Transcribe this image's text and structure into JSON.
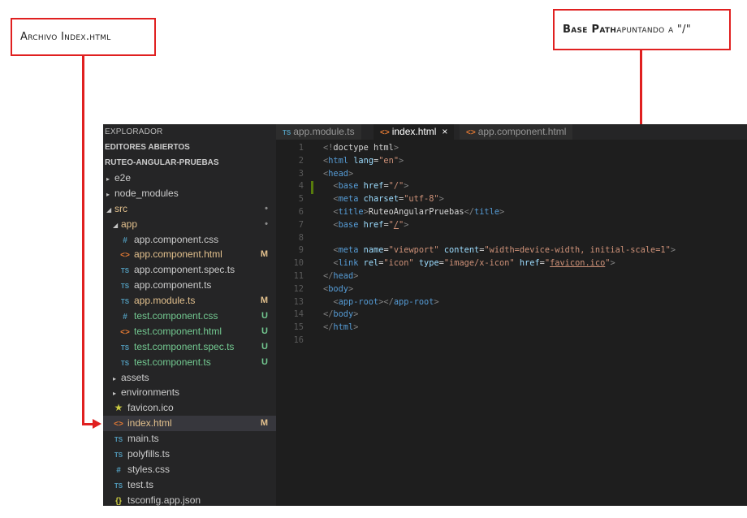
{
  "annotations": {
    "left_label": "Archivo Index.html",
    "right_label_bold": "Base Path",
    "right_label_rest": " apuntando a \"/\""
  },
  "sidebar": {
    "header": "EXPLORADOR",
    "open_editors": "EDITORES ABIERTOS",
    "project": "RUTEO-ANGULAR-PRUEBAS",
    "items": [
      {
        "label": "e2e",
        "icon": "chevron-right",
        "depth": 0,
        "badge": "",
        "color": "default"
      },
      {
        "label": "node_modules",
        "icon": "chevron-right",
        "depth": 0,
        "badge": "",
        "color": "default"
      },
      {
        "label": "src",
        "icon": "chevron-down",
        "depth": 0,
        "badge": "•",
        "color": "mod"
      },
      {
        "label": "app",
        "icon": "chevron-down",
        "depth": 1,
        "badge": "•",
        "color": "mod"
      },
      {
        "label": "app.component.css",
        "icon": "css-icon",
        "depth": 2,
        "badge": "",
        "color": "default"
      },
      {
        "label": "app.component.html",
        "icon": "html-icon",
        "depth": 2,
        "badge": "M",
        "color": "mod"
      },
      {
        "label": "app.component.spec.ts",
        "icon": "ts-icon",
        "depth": 2,
        "badge": "",
        "color": "default"
      },
      {
        "label": "app.component.ts",
        "icon": "ts-icon",
        "depth": 2,
        "badge": "",
        "color": "default"
      },
      {
        "label": "app.module.ts",
        "icon": "ts-icon",
        "depth": 2,
        "badge": "M",
        "color": "mod"
      },
      {
        "label": "test.component.css",
        "icon": "css-icon",
        "depth": 2,
        "badge": "U",
        "color": "new"
      },
      {
        "label": "test.component.html",
        "icon": "html-icon",
        "depth": 2,
        "badge": "U",
        "color": "new"
      },
      {
        "label": "test.component.spec.ts",
        "icon": "ts-icon",
        "depth": 2,
        "badge": "U",
        "color": "new"
      },
      {
        "label": "test.component.ts",
        "icon": "ts-icon",
        "depth": 2,
        "badge": "U",
        "color": "new"
      },
      {
        "label": "assets",
        "icon": "chevron-right",
        "depth": 1,
        "badge": "",
        "color": "default"
      },
      {
        "label": "environments",
        "icon": "chevron-right",
        "depth": 1,
        "badge": "",
        "color": "default"
      },
      {
        "label": "favicon.ico",
        "icon": "star-icon",
        "depth": 1,
        "badge": "",
        "color": "default"
      },
      {
        "label": "index.html",
        "icon": "html-icon",
        "depth": 1,
        "badge": "M",
        "color": "mod",
        "selected": true
      },
      {
        "label": "main.ts",
        "icon": "ts-icon",
        "depth": 1,
        "badge": "",
        "color": "default"
      },
      {
        "label": "polyfills.ts",
        "icon": "ts-icon",
        "depth": 1,
        "badge": "",
        "color": "default"
      },
      {
        "label": "styles.css",
        "icon": "css-icon",
        "depth": 1,
        "badge": "",
        "color": "default"
      },
      {
        "label": "test.ts",
        "icon": "ts-icon",
        "depth": 1,
        "badge": "",
        "color": "default"
      },
      {
        "label": "tsconfig.app.json",
        "icon": "json-icon",
        "depth": 1,
        "badge": "",
        "color": "default"
      }
    ]
  },
  "tabs": [
    {
      "label": "app.module.ts",
      "icon": "ts-icon",
      "active": false
    },
    {
      "label": "index.html",
      "icon": "html-icon",
      "active": true,
      "close": "×"
    },
    {
      "label": "app.component.html",
      "icon": "html-icon",
      "active": false
    }
  ],
  "icon_glyphs": {
    "ts": "TS",
    "css": "#",
    "html": "<>",
    "json": "{}",
    "star": "★",
    "chevron-right": "▸",
    "chevron-down": "◢"
  },
  "code": [
    {
      "n": "1",
      "t": [
        [
          "pu",
          "<!"
        ],
        [
          "tx",
          "doctype html"
        ],
        [
          "pu",
          ">"
        ]
      ]
    },
    {
      "n": "2",
      "t": [
        [
          "pu",
          "<"
        ],
        [
          "tg",
          "html"
        ],
        [
          "tx",
          " "
        ],
        [
          "an",
          "lang"
        ],
        [
          "tx",
          "="
        ],
        [
          "av",
          "\"en\""
        ],
        [
          "pu",
          ">"
        ]
      ]
    },
    {
      "n": "3",
      "t": [
        [
          "pu",
          "<"
        ],
        [
          "tg",
          "head"
        ],
        [
          "pu",
          ">"
        ]
      ]
    },
    {
      "n": "4",
      "t": [
        [
          "tx",
          "  "
        ],
        [
          "pu",
          "<"
        ],
        [
          "tg",
          "base"
        ],
        [
          "tx",
          " "
        ],
        [
          "an",
          "href"
        ],
        [
          "tx",
          "="
        ],
        [
          "av",
          "\"/\""
        ],
        [
          "pu",
          ">"
        ]
      ],
      "mod": true
    },
    {
      "n": "5",
      "t": [
        [
          "tx",
          "  "
        ],
        [
          "pu",
          "<"
        ],
        [
          "tg",
          "meta"
        ],
        [
          "tx",
          " "
        ],
        [
          "an",
          "charset"
        ],
        [
          "tx",
          "="
        ],
        [
          "av",
          "\"utf-8\""
        ],
        [
          "pu",
          ">"
        ]
      ]
    },
    {
      "n": "6",
      "t": [
        [
          "tx",
          "  "
        ],
        [
          "pu",
          "<"
        ],
        [
          "tg",
          "title"
        ],
        [
          "pu",
          ">"
        ],
        [
          "tx",
          "RuteoAngularPruebas"
        ],
        [
          "pu",
          "</"
        ],
        [
          "tg",
          "title"
        ],
        [
          "pu",
          ">"
        ]
      ]
    },
    {
      "n": "7",
      "t": [
        [
          "tx",
          "  "
        ],
        [
          "pu",
          "<"
        ],
        [
          "tg",
          "base"
        ],
        [
          "tx",
          " "
        ],
        [
          "an",
          "href"
        ],
        [
          "tx",
          "="
        ],
        [
          "av",
          "\""
        ],
        [
          "av ul",
          "/"
        ],
        [
          "av",
          "\""
        ],
        [
          "pu",
          ">"
        ]
      ]
    },
    {
      "n": "8",
      "t": []
    },
    {
      "n": "9",
      "t": [
        [
          "tx",
          "  "
        ],
        [
          "pu",
          "<"
        ],
        [
          "tg",
          "meta"
        ],
        [
          "tx",
          " "
        ],
        [
          "an",
          "name"
        ],
        [
          "tx",
          "="
        ],
        [
          "av",
          "\"viewport\""
        ],
        [
          "tx",
          " "
        ],
        [
          "an",
          "content"
        ],
        [
          "tx",
          "="
        ],
        [
          "av",
          "\"width=device-width, initial-scale=1\""
        ],
        [
          "pu",
          ">"
        ]
      ]
    },
    {
      "n": "10",
      "t": [
        [
          "tx",
          "  "
        ],
        [
          "pu",
          "<"
        ],
        [
          "tg",
          "link"
        ],
        [
          "tx",
          " "
        ],
        [
          "an",
          "rel"
        ],
        [
          "tx",
          "="
        ],
        [
          "av",
          "\"icon\""
        ],
        [
          "tx",
          " "
        ],
        [
          "an",
          "type"
        ],
        [
          "tx",
          "="
        ],
        [
          "av",
          "\"image/x-icon\""
        ],
        [
          "tx",
          " "
        ],
        [
          "an",
          "href"
        ],
        [
          "tx",
          "="
        ],
        [
          "av",
          "\""
        ],
        [
          "av ul",
          "favicon.ico"
        ],
        [
          "av",
          "\""
        ],
        [
          "pu",
          ">"
        ]
      ]
    },
    {
      "n": "11",
      "t": [
        [
          "pu",
          "</"
        ],
        [
          "tg",
          "head"
        ],
        [
          "pu",
          ">"
        ]
      ]
    },
    {
      "n": "12",
      "t": [
        [
          "pu",
          "<"
        ],
        [
          "tg",
          "body"
        ],
        [
          "pu",
          ">"
        ]
      ]
    },
    {
      "n": "13",
      "t": [
        [
          "tx",
          "  "
        ],
        [
          "pu",
          "<"
        ],
        [
          "tg",
          "app-root"
        ],
        [
          "pu",
          "></"
        ],
        [
          "tg",
          "app-root"
        ],
        [
          "pu",
          ">"
        ]
      ]
    },
    {
      "n": "14",
      "t": [
        [
          "pu",
          "</"
        ],
        [
          "tg",
          "body"
        ],
        [
          "pu",
          ">"
        ]
      ]
    },
    {
      "n": "15",
      "t": [
        [
          "pu",
          "</"
        ],
        [
          "tg",
          "html"
        ],
        [
          "pu",
          ">"
        ]
      ]
    },
    {
      "n": "16",
      "t": []
    }
  ]
}
